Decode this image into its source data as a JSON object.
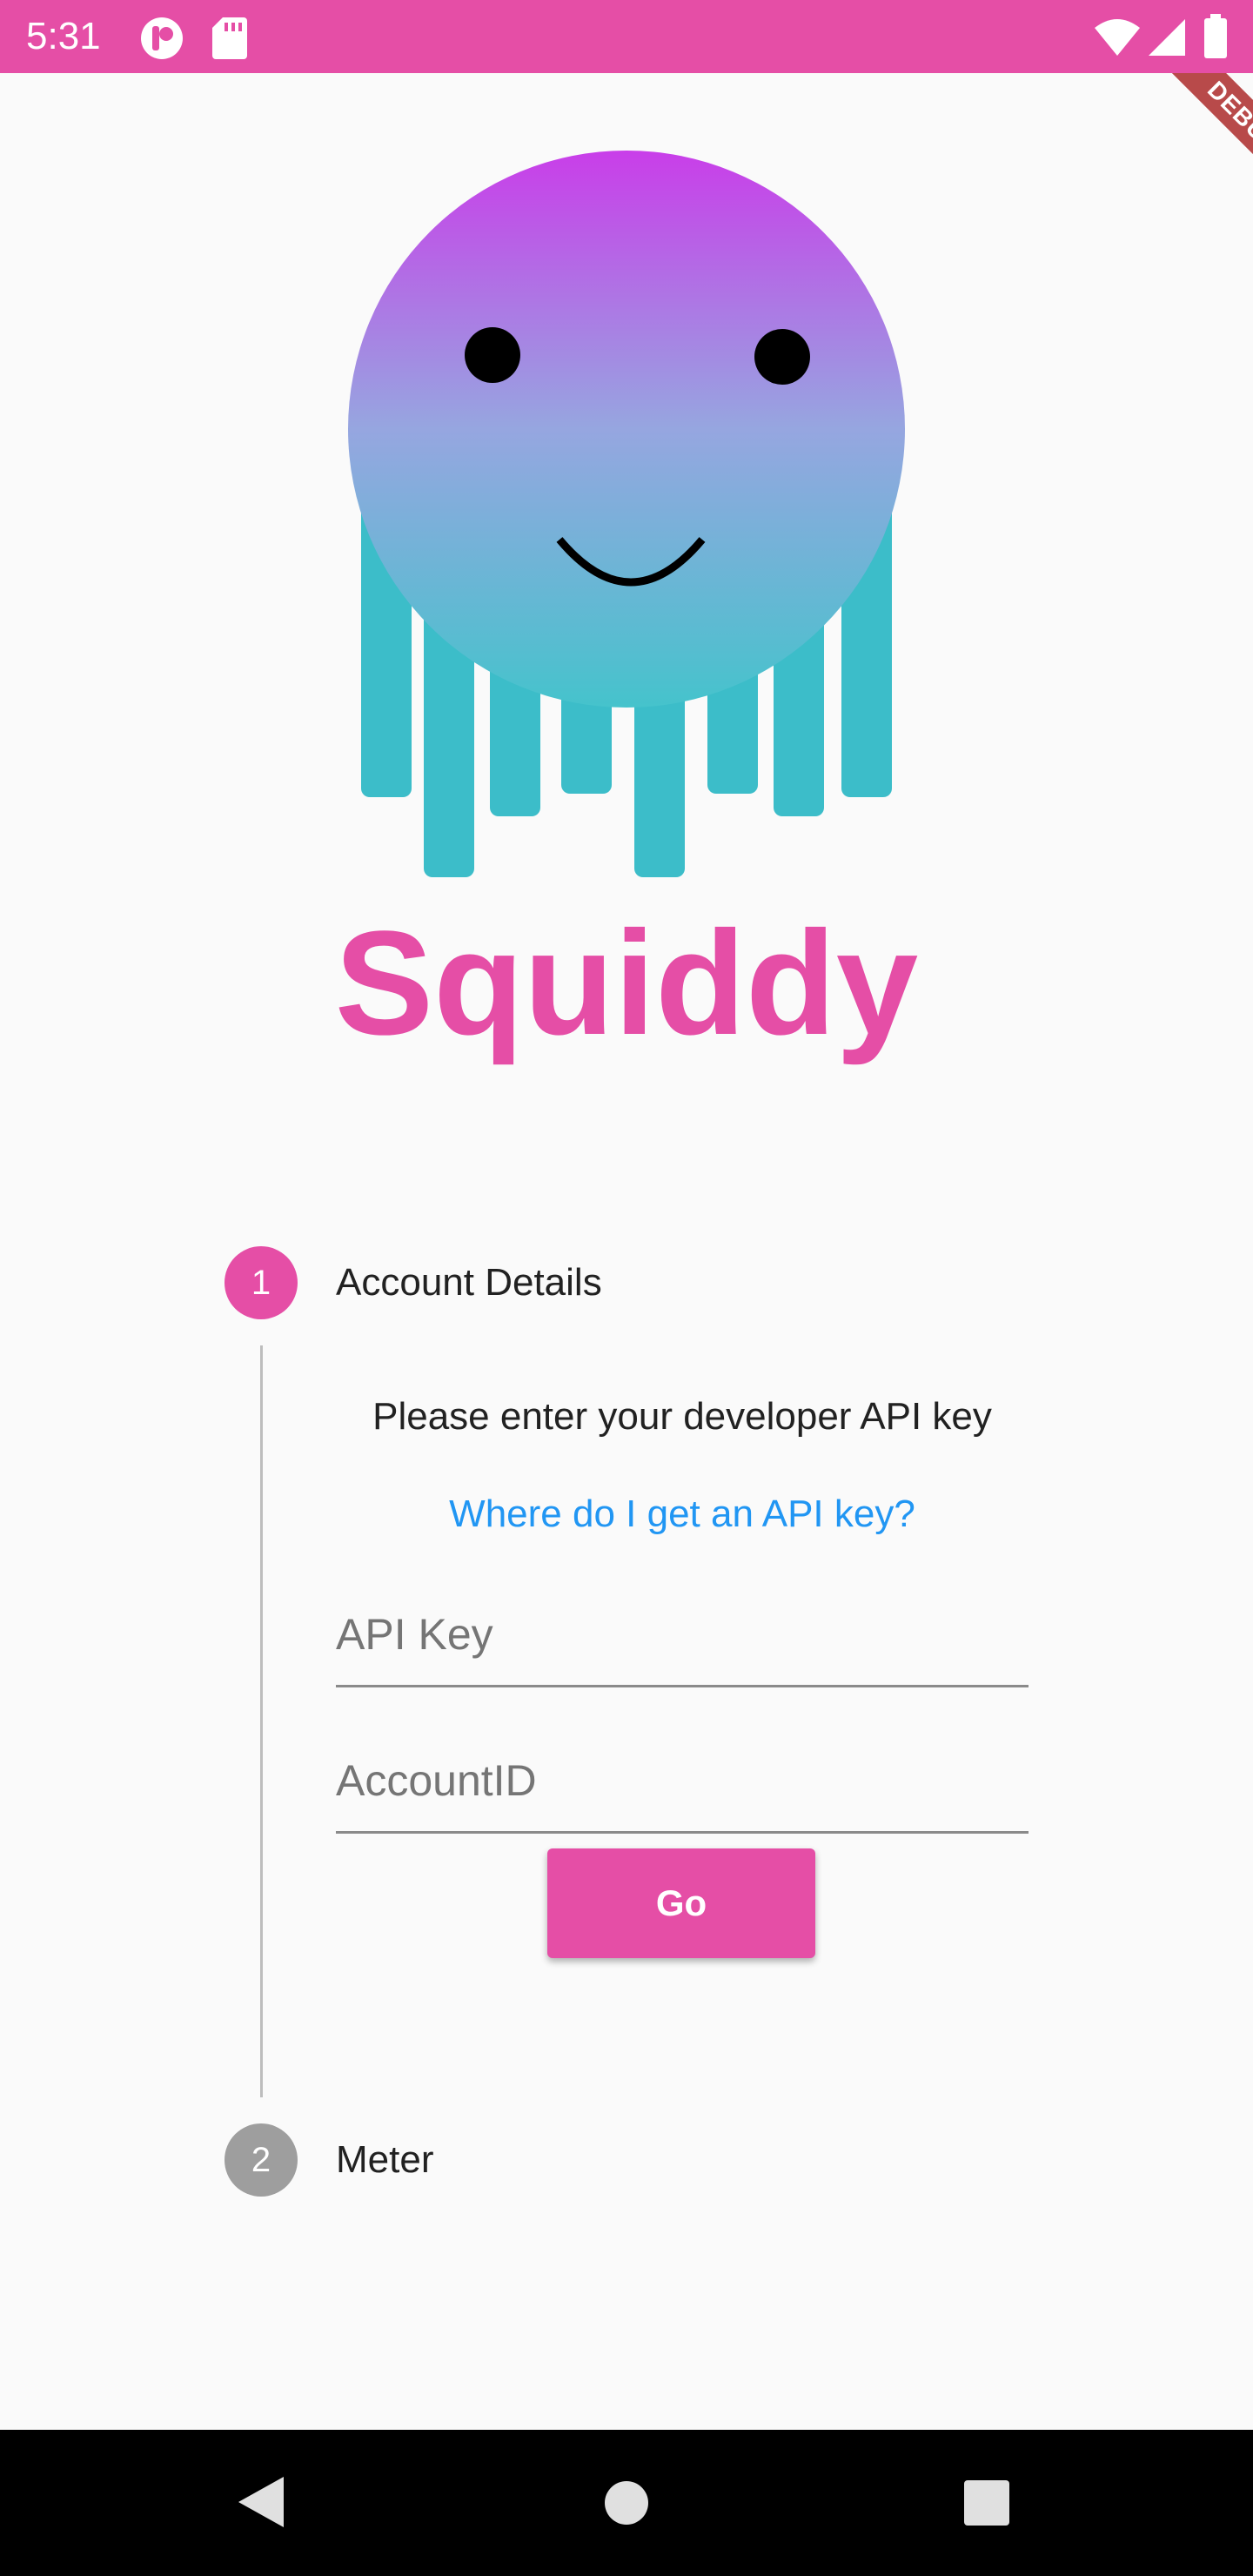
{
  "status_bar": {
    "time": "5:31",
    "icons": [
      "app-notification-icon",
      "sd-card-icon",
      "wifi-icon",
      "signal-icon",
      "battery-icon"
    ],
    "background": "#e54ea6"
  },
  "debug_banner": {
    "label": "DEBUG"
  },
  "app": {
    "title": "Squiddy",
    "brand_color": "#e54ea6",
    "logo": "squid-logo"
  },
  "stepper": {
    "steps": [
      {
        "number": "1",
        "title": "Account Details",
        "state": "active"
      },
      {
        "number": "2",
        "title": "Meter",
        "state": "inactive"
      }
    ]
  },
  "account_step": {
    "instruction": "Please enter your developer API key",
    "help_link": "Where do I get an API key?",
    "api_key_placeholder": "API Key",
    "account_id_placeholder": "AccountID",
    "api_key_value": "",
    "account_id_value": "",
    "go_label": "Go"
  },
  "nav_bar": {
    "icons": [
      "back-icon",
      "home-icon",
      "recents-icon"
    ]
  }
}
